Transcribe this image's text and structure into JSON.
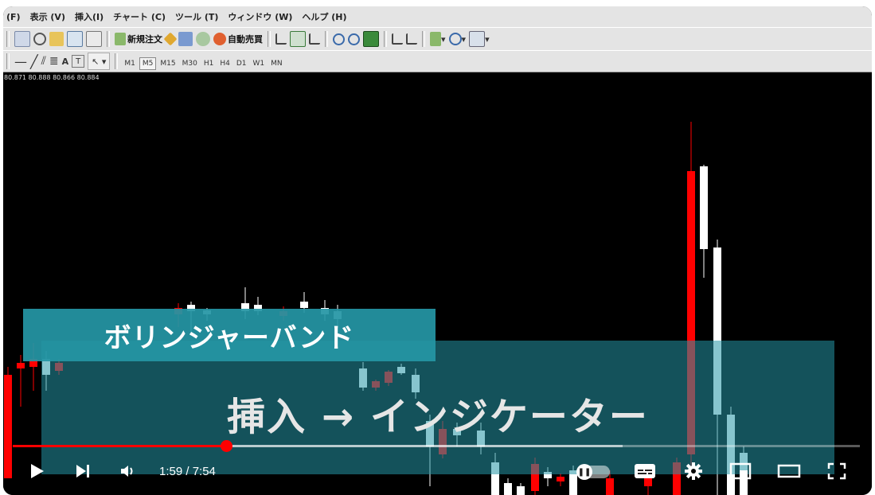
{
  "menu": [
    "(F)",
    "表示 (V)",
    "挿入(I)",
    "チャート (C)",
    "ツール (T)",
    "ウィンドウ (W)",
    "ヘルプ (H)"
  ],
  "toolbar": {
    "new_order_label": "新規注文",
    "auto_trade_label": "自動売買"
  },
  "timeframes": [
    "M1",
    "M5",
    "M15",
    "M30",
    "H1",
    "H4",
    "D1",
    "W1",
    "MN"
  ],
  "active_timeframe": "M5",
  "chart": {
    "ohlc_text": "80.871 80.888 80.866 80.884",
    "bull_color": "#ffffff",
    "bear_color": "#ff0000"
  },
  "overlay": {
    "title": "ボリンジャーバンド",
    "subtitle": "挿入 → インジケーター"
  },
  "player": {
    "time": "1:59 / 7:54",
    "progress": 0.252,
    "buffered": 0.72
  }
}
